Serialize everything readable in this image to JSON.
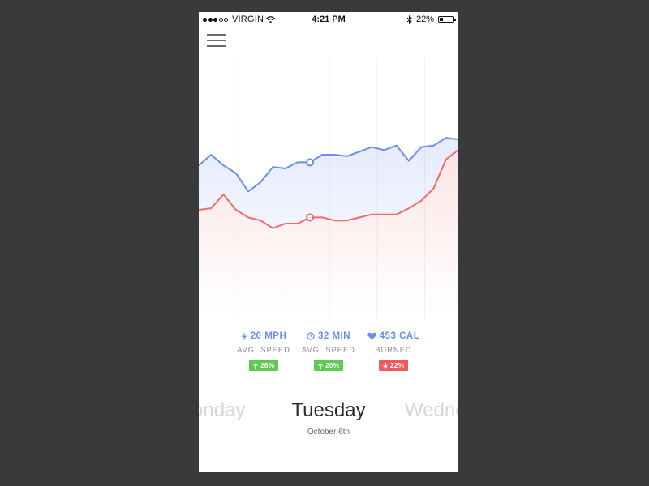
{
  "status_bar": {
    "carrier": "VIRGIN",
    "time": "4:21 PM",
    "battery": "22%",
    "battery_level": 0.22
  },
  "colors": {
    "blue": "#6b8df0",
    "red": "#ef6b6b",
    "green": "#5bcc4f",
    "badge_red": "#ef5b5b"
  },
  "stats": [
    {
      "icon": "bolt-icon",
      "value": "20 MPH",
      "label": "AVG. SPEED",
      "change": "28%",
      "direction": "up",
      "color": "#6b8df0",
      "badge_color": "#5bcc4f"
    },
    {
      "icon": "clock-icon",
      "value": "32 MIN",
      "label": "AVG. SPEED",
      "change": "20%",
      "direction": "up",
      "color": "#6b8df0",
      "badge_color": "#5bcc4f"
    },
    {
      "icon": "heart-icon",
      "value": "453 CAL",
      "label": "BURNED",
      "change": "22%",
      "direction": "down",
      "color": "#6b8df0",
      "badge_color": "#ef5b5b"
    }
  ],
  "days": {
    "previous": "onday",
    "current": "Tuesday",
    "next": "Wedne",
    "date": "October 6th"
  },
  "chart_data": {
    "type": "area",
    "series": [
      {
        "values": [
          6.6,
          7.3,
          6.6,
          6.1,
          4.9,
          5.5,
          6.5,
          6.4,
          6.8,
          6.8,
          7.3,
          7.3,
          7.2,
          7.5,
          7.8,
          7.6,
          7.9,
          6.9,
          7.8,
          7.9,
          8.4,
          8.3
        ]
      },
      {
        "values": [
          3.7,
          3.8,
          4.7,
          3.7,
          3.2,
          3.0,
          2.5,
          2.8,
          2.8,
          3.2,
          3.2,
          3.0,
          3.0,
          3.2,
          3.4,
          3.4,
          3.4,
          3.8,
          4.3,
          5.1,
          7.0,
          7.6
        ]
      }
    ],
    "highlight_index": 9,
    "ylim": [
      0,
      10
    ],
    "grid": "vertical"
  }
}
